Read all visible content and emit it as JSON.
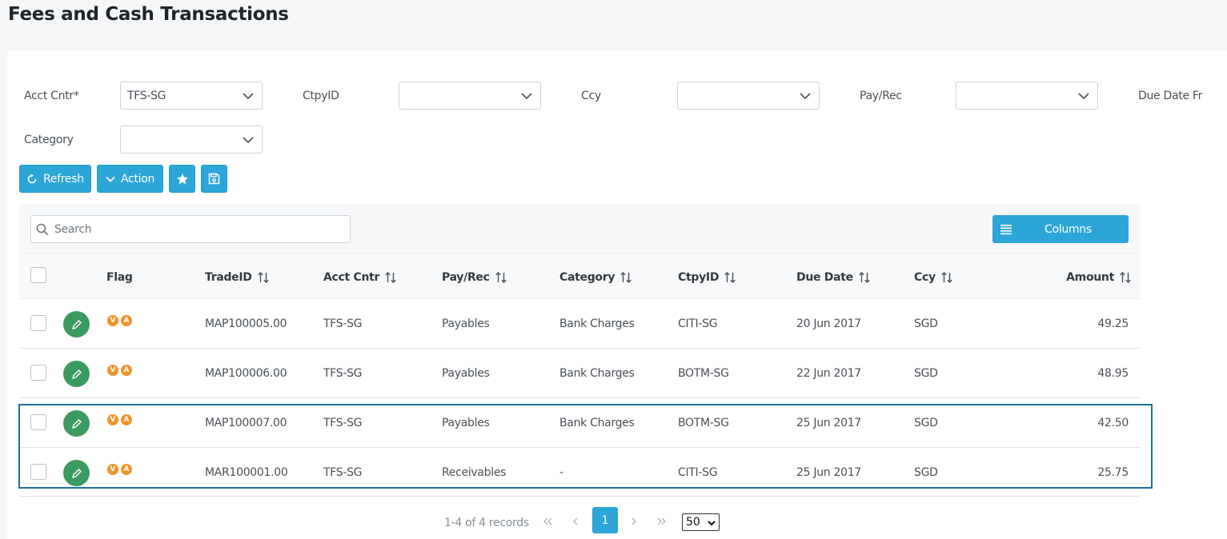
{
  "page_title": "Fees and Cash Transactions",
  "filters": {
    "acct_cntr": {
      "label": "Acct Cntr*",
      "value": "TFS-SG"
    },
    "ctpyid": {
      "label": "CtpyID",
      "value": ""
    },
    "ccy": {
      "label": "Ccy",
      "value": ""
    },
    "pay_rec": {
      "label": "Pay/Rec",
      "value": ""
    },
    "due_date_fr": {
      "label": "Due Date Fr"
    },
    "category": {
      "label": "Category",
      "value": ""
    }
  },
  "toolbar": {
    "refresh_label": "Refresh",
    "action_label": "Action",
    "search_placeholder": "Search",
    "columns_label": "Columns"
  },
  "table": {
    "headers": {
      "flag": "Flag",
      "tradeid": "TradeID",
      "acct_cntr": "Acct Cntr",
      "pay_rec": "Pay/Rec",
      "category": "Category",
      "ctpyid": "CtpyID",
      "due_date": "Due Date",
      "ccy": "Ccy",
      "amount": "Amount"
    },
    "rows": [
      {
        "flags": [
          "V",
          "A"
        ],
        "tradeid": "MAP100005.00",
        "acct_cntr": "TFS-SG",
        "pay_rec": "Payables",
        "category": "Bank Charges",
        "ctpyid": "CITI-SG",
        "due_date": "20 Jun 2017",
        "ccy": "SGD",
        "amount": "49.25"
      },
      {
        "flags": [
          "V",
          "A"
        ],
        "tradeid": "MAP100006.00",
        "acct_cntr": "TFS-SG",
        "pay_rec": "Payables",
        "category": "Bank Charges",
        "ctpyid": "BOTM-SG",
        "due_date": "22 Jun 2017",
        "ccy": "SGD",
        "amount": "48.95"
      },
      {
        "flags": [
          "V",
          "A"
        ],
        "tradeid": "MAP100007.00",
        "acct_cntr": "TFS-SG",
        "pay_rec": "Payables",
        "category": "Bank Charges",
        "ctpyid": "BOTM-SG",
        "due_date": "25 Jun 2017",
        "ccy": "SGD",
        "amount": "42.50"
      },
      {
        "flags": [
          "V",
          "A"
        ],
        "tradeid": "MAR100001.00",
        "acct_cntr": "TFS-SG",
        "pay_rec": "Receivables",
        "category": "-",
        "ctpyid": "CITI-SG",
        "due_date": "25 Jun 2017",
        "ccy": "SGD",
        "amount": "25.75"
      }
    ]
  },
  "pagination": {
    "info": "1-4 of 4 records",
    "current_page": "1",
    "page_size": "50"
  },
  "colors": {
    "accent": "#2ca6d8",
    "edit_button": "#3b9a5d",
    "flag_badge": "#f0932b",
    "selection_border": "#1f6e9e"
  }
}
